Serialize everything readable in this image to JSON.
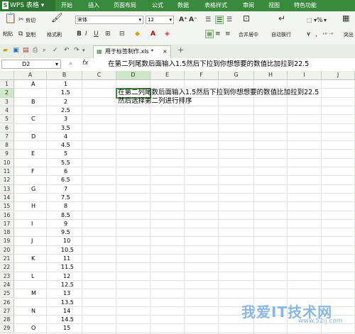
{
  "app": {
    "logo_mark": "S",
    "name": "WPS 表格"
  },
  "menu": [
    "开始",
    "插入",
    "页面布局",
    "公式",
    "数据",
    "表格样式",
    "审阅",
    "视图",
    "特色功能"
  ],
  "ribbon": {
    "cut": "剪切",
    "paste": "粘贴",
    "copy": "复制",
    "format_painter": "格式刷",
    "font": "宋体",
    "size": "12",
    "merge_center": "合并居中",
    "auto_wrap": "自动换行",
    "percent": "%",
    "number_fmt": "¥",
    "comma": ",",
    "right_tail": "突出"
  },
  "tabbar": {
    "file_tab": "用于标签制作.xls *",
    "close_mark": "×",
    "new_tab": "+"
  },
  "formula_bar": {
    "cell_ref": "D2",
    "fx": "fx",
    "text": "在第二列尾数后面输入1.5然后下拉到你想想要的数值比加拉到22.5"
  },
  "sheet": {
    "columns": [
      "A",
      "B",
      "C",
      "D",
      "E",
      "F",
      "G",
      "H",
      "I",
      "J"
    ],
    "active_col": "D",
    "active_row": 2,
    "rows": [
      {
        "n": "1",
        "a": "A",
        "b": "1"
      },
      {
        "n": "2",
        "a": "",
        "b": "1.5"
      },
      {
        "n": "3",
        "a": "B",
        "b": "2"
      },
      {
        "n": "4",
        "a": "",
        "b": "2.5"
      },
      {
        "n": "5",
        "a": "C",
        "b": "3"
      },
      {
        "n": "6",
        "a": "",
        "b": "3.5"
      },
      {
        "n": "7",
        "a": "D",
        "b": "4"
      },
      {
        "n": "8",
        "a": "",
        "b": "4.5"
      },
      {
        "n": "9",
        "a": "E",
        "b": "5"
      },
      {
        "n": "10",
        "a": "",
        "b": "5.5"
      },
      {
        "n": "11",
        "a": "F",
        "b": "6"
      },
      {
        "n": "12",
        "a": "",
        "b": "6.5"
      },
      {
        "n": "13",
        "a": "G",
        "b": "7"
      },
      {
        "n": "14",
        "a": "",
        "b": "7.5"
      },
      {
        "n": "15",
        "a": "H",
        "b": "8"
      },
      {
        "n": "16",
        "a": "",
        "b": "8.5"
      },
      {
        "n": "17",
        "a": "I",
        "b": "9"
      },
      {
        "n": "18",
        "a": "",
        "b": "9.5"
      },
      {
        "n": "19",
        "a": "J",
        "b": "10"
      },
      {
        "n": "20",
        "a": "",
        "b": "10.5"
      },
      {
        "n": "21",
        "a": "K",
        "b": "11"
      },
      {
        "n": "22",
        "a": "",
        "b": "11.5"
      },
      {
        "n": "23",
        "a": "L",
        "b": "12"
      },
      {
        "n": "24",
        "a": "",
        "b": "12.5"
      },
      {
        "n": "25",
        "a": "M",
        "b": "13"
      },
      {
        "n": "26",
        "a": "",
        "b": "13.5"
      },
      {
        "n": "27",
        "a": "N",
        "b": "14"
      },
      {
        "n": "28",
        "a": "",
        "b": "14.5"
      },
      {
        "n": "29",
        "a": "O",
        "b": "15"
      }
    ],
    "d2_line1": "在第二列尾数后面输入1.5然后下拉到你想想要的数值比加拉到22.5",
    "d2_line2": "然后选择第二列进行排序"
  },
  "watermark": {
    "brand": "我爱IT技术网",
    "url": "www.52ij.com"
  },
  "colors": {
    "menubar": "#3a8a3e",
    "selection": "#3d8a3d",
    "header_active": "#cfe6c8"
  }
}
